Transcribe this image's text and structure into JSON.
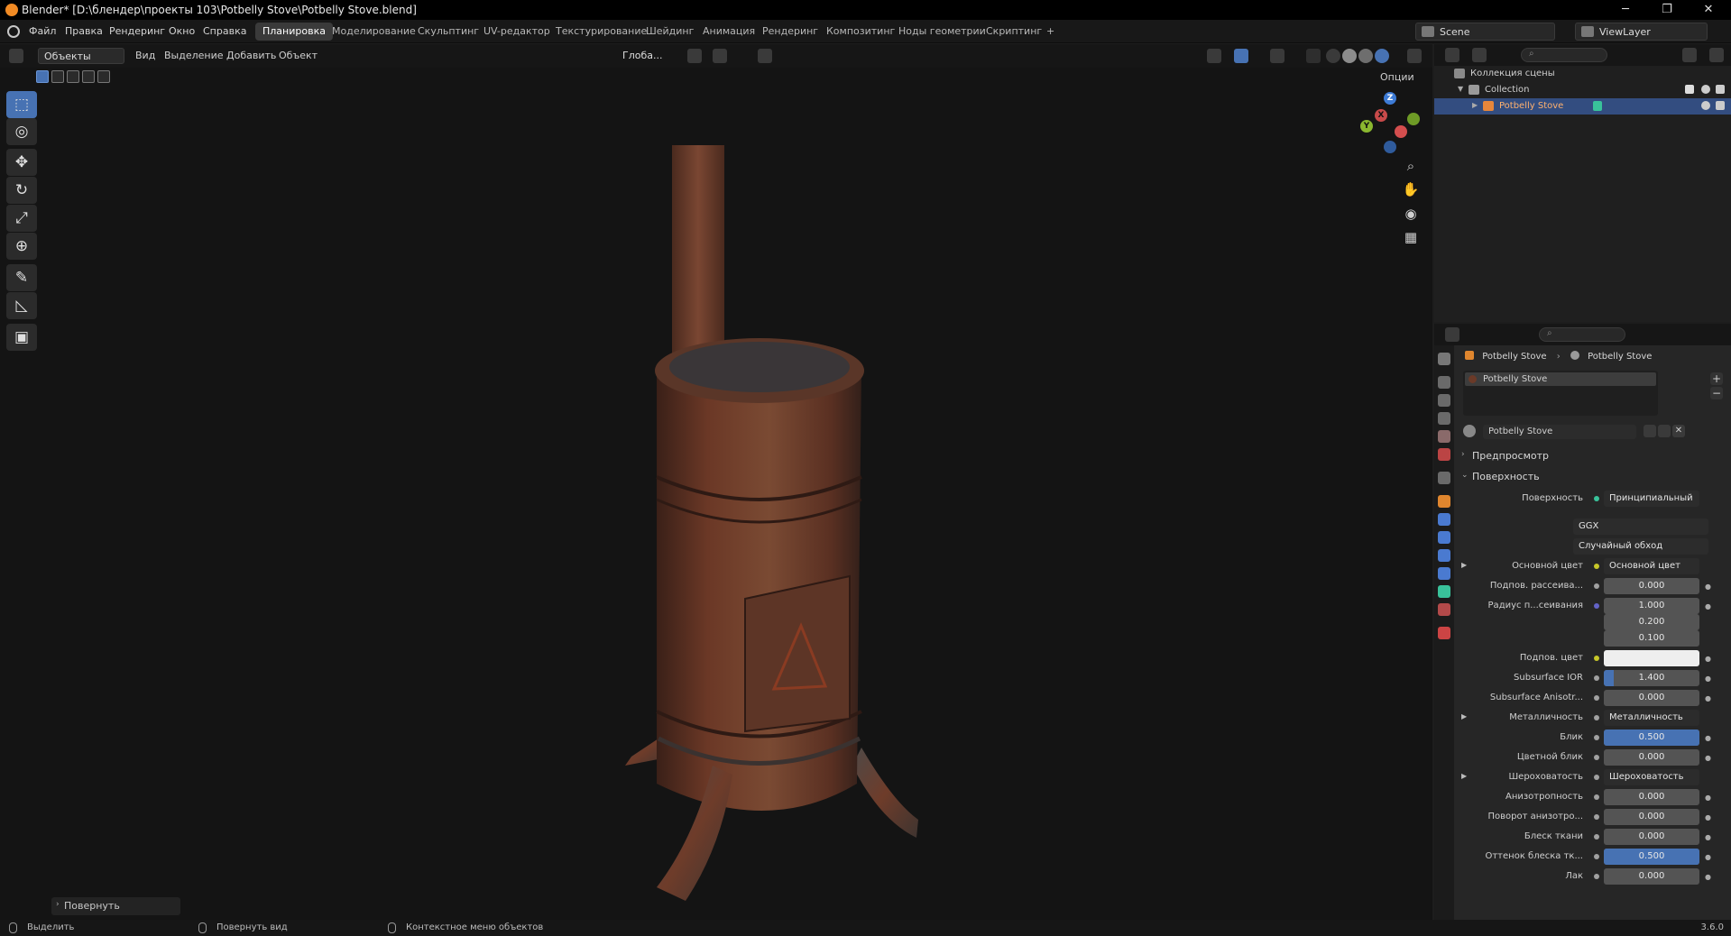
{
  "titlebar": {
    "title": "Blender* [D:\\блендер\\проекты 103\\Potbelly Stove\\Potbelly Stove.blend]",
    "minimize": "─",
    "maximize": "❐",
    "close": "✕"
  },
  "menu": {
    "file": "Файл",
    "edit": "Правка",
    "render": "Рендеринг",
    "window": "Окно",
    "help": "Справка"
  },
  "workspaces": [
    {
      "label": "Планировка",
      "active": true
    },
    {
      "label": "Моделирование"
    },
    {
      "label": "Скульптинг"
    },
    {
      "label": "UV-редактор"
    },
    {
      "label": "Текстурирование"
    },
    {
      "label": "Шейдинг"
    },
    {
      "label": "Анимация"
    },
    {
      "label": "Рендеринг"
    },
    {
      "label": "Композитинг"
    },
    {
      "label": "Ноды геометрии"
    },
    {
      "label": "Скриптинг"
    },
    {
      "label": "+"
    }
  ],
  "scene": {
    "label": "Scene",
    "view_layer": "ViewLayer"
  },
  "viewport_header": {
    "mode": "Объекты",
    "view": "Вид",
    "select": "Выделение",
    "add": "Добавить",
    "object": "Объект",
    "transform_orientation": "Глоба...",
    "options": "Опции"
  },
  "toolbar": {
    "tools": [
      "select-box",
      "cursor",
      "move",
      "rotate",
      "scale",
      "transform",
      "annotate",
      "measure",
      "add-cube"
    ]
  },
  "gizmo": {
    "x": "X",
    "y": "Y",
    "z": "Z"
  },
  "last_operator": "Повернуть",
  "outliner": {
    "scene_collection": "Коллекция сцены",
    "collection": "Collection",
    "object": "Potbelly Stove"
  },
  "properties": {
    "breadcrumb_object": "Potbelly Stove",
    "breadcrumb_material": "Potbelly Stove",
    "slot_name": "Potbelly Stove",
    "material_name": "Potbelly Stove",
    "panels": {
      "preview": "Предпросмотр",
      "surface": "Поверхность"
    },
    "surface_label": "Поверхность",
    "surface_value": "Принципиальный BSDF",
    "distribution": "GGX",
    "subsurface_method": "Случайный обход",
    "rows": {
      "base_color_label": "Основной цвет",
      "base_color_value": "Основной цвет",
      "subsurface_label": "Подпов. рассеива...",
      "subsurface_value": "0.000",
      "subsurface_radius_label": "Радиус п...сеивания",
      "radius_1": "1.000",
      "radius_2": "0.200",
      "radius_3": "0.100",
      "subsurface_color_label": "Подпов. цвет",
      "subsurface_ior_label": "Subsurface IOR",
      "subsurface_ior_value": "1.400",
      "subsurface_aniso_label": "Subsurface Anisotr...",
      "subsurface_aniso_value": "0.000",
      "metallic_label": "Металличность",
      "metallic_value": "Металличность",
      "specular_label": "Блик",
      "specular_value": "0.500",
      "specular_tint_label": "Цветной блик",
      "specular_tint_value": "0.000",
      "roughness_label": "Шероховатость",
      "roughness_value": "Шероховатость",
      "anisotropic_label": "Анизотропность",
      "anisotropic_value": "0.000",
      "aniso_rotation_label": "Поворот анизотро...",
      "aniso_rotation_value": "0.000",
      "sheen_label": "Блеск ткани",
      "sheen_value": "0.000",
      "sheen_tint_label": "Оттенок блеска тк...",
      "sheen_tint_value": "0.500",
      "clearcoat_label": "Лак",
      "clearcoat_value": "0.000"
    },
    "fills": {
      "subsurface_ior": 0.1,
      "specular": 1.0,
      "sheen_tint": 1.0
    }
  },
  "statusbar": {
    "select": "Выделить",
    "rotate_view": "Повернуть вид",
    "context_menu": "Контекстное меню объектов",
    "version": "3.6.0"
  },
  "colors": {
    "accent": "#4772b3",
    "selection": "#334d80",
    "rust": "#6e3a26",
    "blender_orange": "#f08a24"
  }
}
